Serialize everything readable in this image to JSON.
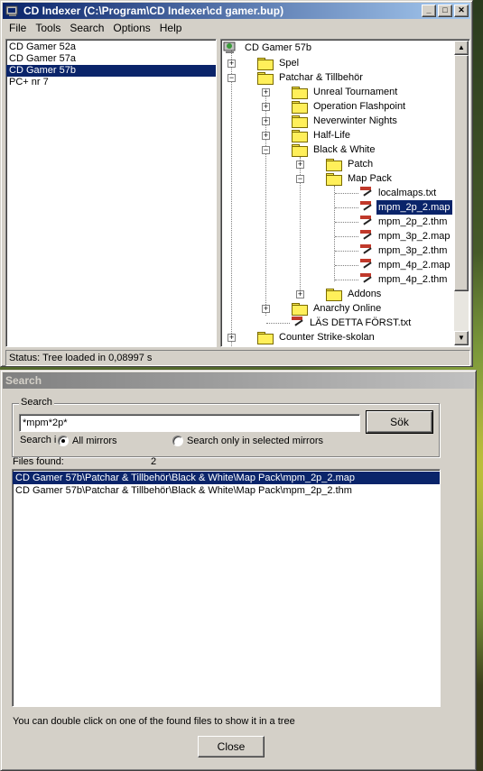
{
  "main_window": {
    "title": "CD Indexer (C:\\Program\\CD Indexer\\cd gamer.bup)",
    "menu": [
      "File",
      "Tools",
      "Search",
      "Options",
      "Help"
    ],
    "mirrors": [
      {
        "label": "CD Gamer 52a",
        "selected": false
      },
      {
        "label": "CD Gamer 57a",
        "selected": false
      },
      {
        "label": "CD Gamer 57b",
        "selected": true
      },
      {
        "label": "PC+ nr 7",
        "selected": false
      }
    ],
    "tree": {
      "root": "CD Gamer 57b",
      "spel": "Spel",
      "patchar": "Patchar & Tillbehör",
      "unreal": "Unreal Tournament",
      "operation": "Operation Flashpoint",
      "neverwinter": "Neverwinter Nights",
      "halflife": "Half-Life",
      "blackwhite": "Black & White",
      "patch": "Patch",
      "mappack": "Map Pack",
      "files": [
        {
          "label": "localmaps.txt",
          "selected": false
        },
        {
          "label": "mpm_2p_2.map",
          "selected": true
        },
        {
          "label": "mpm_2p_2.thm",
          "selected": false
        },
        {
          "label": "mpm_3p_2.map",
          "selected": false
        },
        {
          "label": "mpm_3p_2.thm",
          "selected": false
        },
        {
          "label": "mpm_4p_2.map",
          "selected": false
        },
        {
          "label": "mpm_4p_2.thm",
          "selected": false
        }
      ],
      "addons": "Addons",
      "anarchy": "Anarchy Online",
      "lasdetta": "LÄS DETTA FÖRST.txt",
      "counterstrike": "Counter Strike-skolan"
    },
    "status": "Status: Tree loaded in 0,08997 s"
  },
  "search_window": {
    "title": "Search",
    "group_label": "Search",
    "query": "*mpm*2p*",
    "search_button": "Sök",
    "search_in_label": "Search i",
    "radio_all": "All mirrors",
    "radio_selected": "Search only in selected mirrors",
    "radio_all_checked": true,
    "files_found_label": "Files found:",
    "files_found_count": "2",
    "results": [
      {
        "path": "CD Gamer 57b\\Patchar & Tillbehör\\Black & White\\Map Pack\\mpm_2p_2.map",
        "selected": true
      },
      {
        "path": "CD Gamer 57b\\Patchar & Tillbehör\\Black & White\\Map Pack\\mpm_2p_2.thm",
        "selected": false
      }
    ],
    "hint": "You can double click on one of the found files to show it in a tree",
    "close_button": "Close"
  },
  "colors": {
    "selection": "#0a246a",
    "active_title": "#0a246a",
    "face": "#d4d0c8"
  }
}
